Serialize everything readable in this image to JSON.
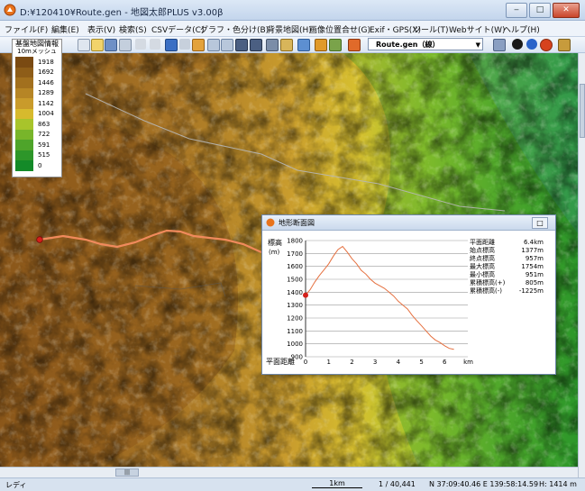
{
  "window": {
    "title": "D:¥120410¥Route.gen - 地図太郎PLUS v3.00β",
    "min": "‒",
    "max": "□",
    "close": "✕"
  },
  "menu": [
    "ファイル(F)",
    "編集(E)",
    "表示(V)",
    "検索(S)",
    "CSVデータ(C)",
    "グラフ・色分け(B)",
    "背景地図(H)",
    "画像位置合せ(G)",
    "Exif・GPS(X)",
    "ツール(T)",
    "Webサイト(W)",
    "ヘルプ(H)"
  ],
  "toolbar": {
    "route_select": "Route.gen（線）"
  },
  "legend": {
    "title": "基盤地図情報",
    "subtitle": "10mメッシュ",
    "entries": [
      {
        "label": "1918",
        "color": "#7a4a12"
      },
      {
        "label": "1692",
        "color": "#8e5d18"
      },
      {
        "label": "1446",
        "color": "#a2701e"
      },
      {
        "label": "1289",
        "color": "#b68525"
      },
      {
        "label": "1142",
        "color": "#c99b2b"
      },
      {
        "label": "1004",
        "color": "#d7ba2d"
      },
      {
        "label": "863",
        "color": "#a8c42b"
      },
      {
        "label": "722",
        "color": "#78b52a"
      },
      {
        "label": "591",
        "color": "#4ea42a"
      },
      {
        "label": "515",
        "color": "#2d9629"
      },
      {
        "label": "0",
        "color": "#138a28"
      }
    ]
  },
  "profile": {
    "title": "地形断面図",
    "close": "□",
    "ylabel": "標高",
    "yunit": "(m)",
    "xlabel": "平面距離",
    "xunit": "km",
    "stats": [
      {
        "label": "平面距離",
        "value": "6.4km"
      },
      {
        "label": "始点標高",
        "value": "1377m"
      },
      {
        "label": "終点標高",
        "value": "957m"
      },
      {
        "label": "最大標高",
        "value": "1754m"
      },
      {
        "label": "最小標高",
        "value": "951m"
      },
      {
        "label": "累積標高(+)",
        "value": "805m"
      },
      {
        "label": "累積標高(-)",
        "value": "-1225m"
      }
    ]
  },
  "chart_data": {
    "type": "line",
    "xlabel": "平面距離",
    "ylabel": "標高",
    "xlim": [
      0,
      7
    ],
    "ylim": [
      900,
      1800
    ],
    "xticks": [
      0,
      1,
      2,
      3,
      4,
      5,
      6,
      7
    ],
    "yticks": [
      900,
      1000,
      1100,
      1200,
      1300,
      1400,
      1500,
      1600,
      1700,
      1800
    ],
    "grid": true,
    "x": [
      0.0,
      0.2,
      0.4,
      0.6,
      0.8,
      1.0,
      1.2,
      1.4,
      1.6,
      1.8,
      2.0,
      2.2,
      2.4,
      2.6,
      2.8,
      3.0,
      3.2,
      3.4,
      3.6,
      3.8,
      4.0,
      4.2,
      4.4,
      4.6,
      4.8,
      5.0,
      5.2,
      5.4,
      5.6,
      5.8,
      6.0,
      6.2,
      6.4
    ],
    "y": [
      1377,
      1420,
      1480,
      1530,
      1575,
      1620,
      1680,
      1730,
      1754,
      1710,
      1660,
      1620,
      1570,
      1540,
      1500,
      1470,
      1450,
      1430,
      1400,
      1370,
      1330,
      1300,
      1270,
      1220,
      1180,
      1140,
      1100,
      1060,
      1030,
      1010,
      985,
      965,
      957
    ],
    "start_marker": {
      "x": 0,
      "y": 1377
    }
  },
  "status": {
    "ready": "レディ",
    "scale_bar": "1km",
    "scale": "1 / 40,441",
    "coords": "N 37:09:40.46  E 139:58:14.59",
    "height": "H: 1414 m"
  }
}
